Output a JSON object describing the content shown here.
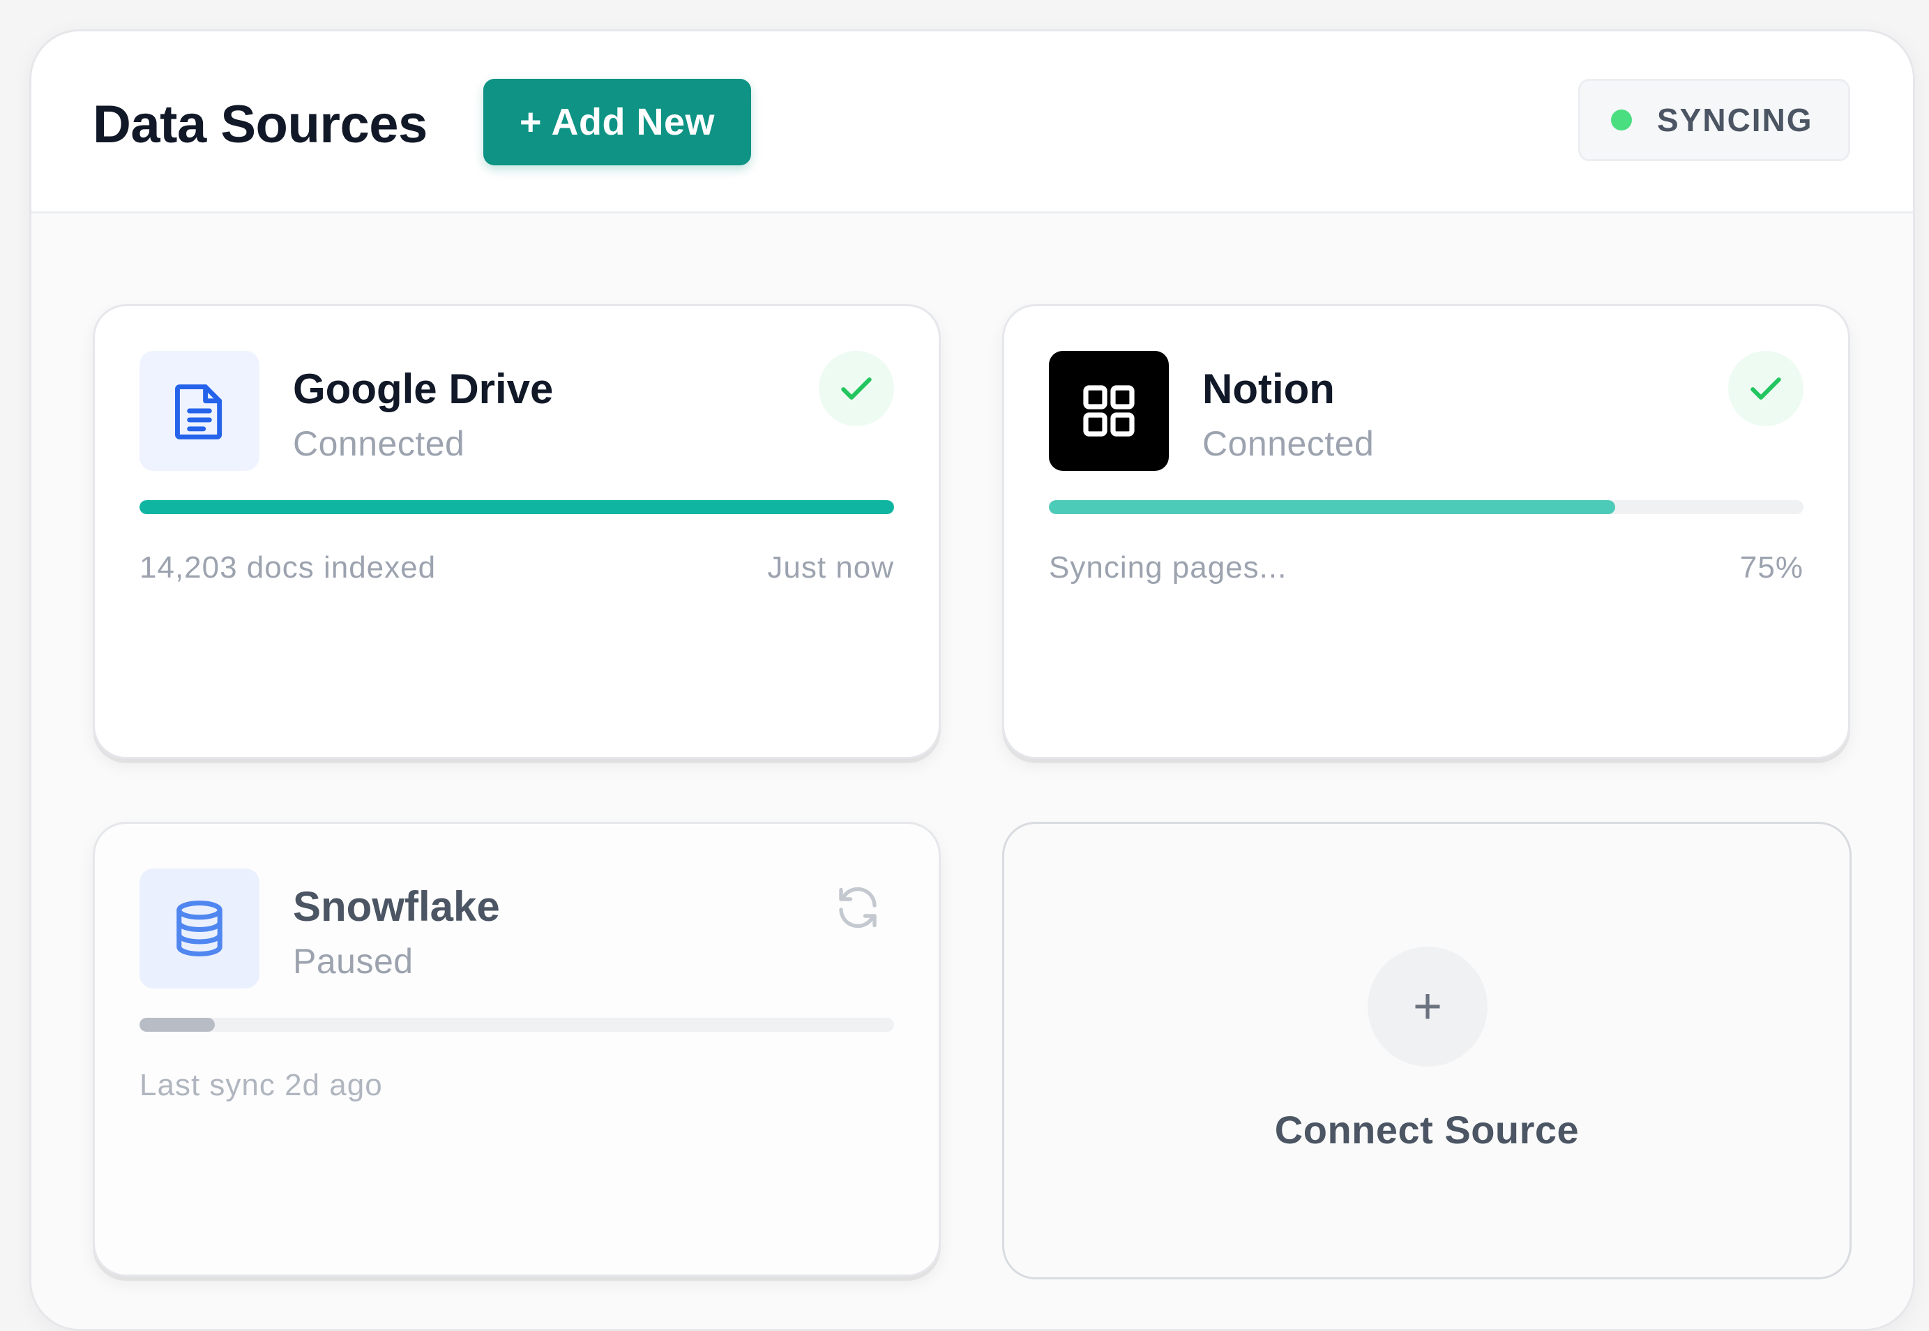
{
  "header": {
    "title": "Data Sources",
    "add_button": "+ Add New",
    "status_badge": "SYNCING"
  },
  "sources": [
    {
      "name": "Google Drive",
      "status": "Connected",
      "progress_percent": 100,
      "meta_left": "14,203 docs indexed",
      "meta_right": "Just now",
      "icon": "document-icon",
      "state_icon": "check-icon",
      "colors": {
        "icon_bg": "#eef3ff",
        "icon_fg": "#2563eb",
        "progress": "#0fb5a1"
      }
    },
    {
      "name": "Notion",
      "status": "Connected",
      "progress_percent": 75,
      "meta_left": "Syncing pages...",
      "meta_right": "75%",
      "icon": "grid-icon",
      "state_icon": "check-icon",
      "colors": {
        "icon_bg": "#000000",
        "icon_fg": "#ffffff",
        "progress": "#4ccbb8"
      }
    },
    {
      "name": "Snowflake",
      "status": "Paused",
      "progress_percent": 10,
      "meta_left": "Last sync 2d ago",
      "meta_right": "",
      "icon": "database-icon",
      "state_icon": "refresh-icon",
      "colors": {
        "icon_bg": "#eaf0fd",
        "icon_fg": "#4f86f0",
        "progress": "#b8bcc4"
      }
    }
  ],
  "connect_card": {
    "plus": "+",
    "label": "Connect Source"
  },
  "colors": {
    "accent": "#0e9384",
    "success": "#22c55e",
    "sync_dot": "#4ade80"
  }
}
